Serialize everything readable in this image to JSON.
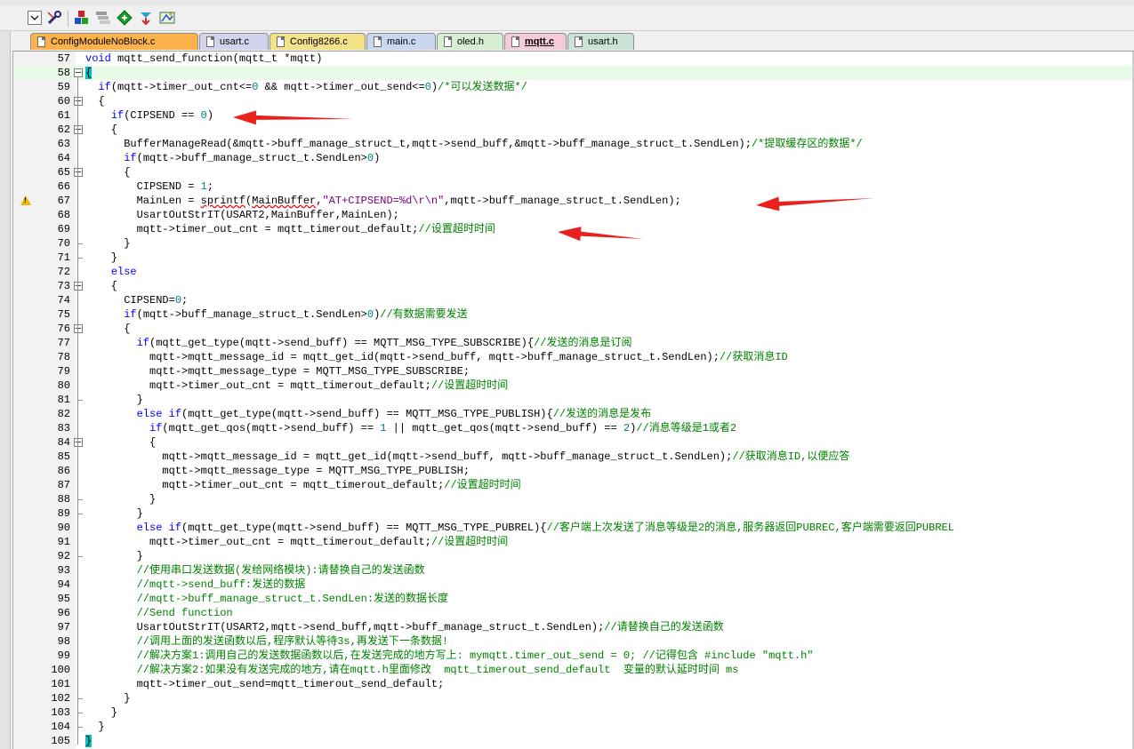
{
  "tabs": [
    {
      "label": "ConfigModuleNoBlock.c",
      "bg": "#fbb24a",
      "active": false
    },
    {
      "label": "usart.c",
      "bg": "#d3d3ee",
      "active": false
    },
    {
      "label": "Config8266.c",
      "bg": "#f4e28a",
      "active": false
    },
    {
      "label": "main.c",
      "bg": "#c9d8ee",
      "active": false
    },
    {
      "label": "oled.h",
      "bg": "#d7eed2",
      "active": false
    },
    {
      "label": "mqtt.c",
      "bg": "#f6cbd8",
      "active": true
    },
    {
      "label": "usart.h",
      "bg": "#c9e4d6",
      "active": false
    }
  ],
  "toolbar_icons": [
    "dropdown-icon",
    "wrench-icon",
    "build-target-icon",
    "batch-build-icon",
    "translate-icon",
    "download-icon",
    "options-icon"
  ],
  "editor": {
    "highlight_line": 58,
    "warning_line": 67,
    "lines": [
      {
        "n": "57",
        "text": "void mqtt_send_function(mqtt_t *mqtt)"
      },
      {
        "n": "58",
        "text": "{"
      },
      {
        "n": "59",
        "text": "  if(mqtt->timer_out_cnt<=0 && mqtt->timer_out_send<=0)/*可以发送数据*/"
      },
      {
        "n": "60",
        "text": "  {"
      },
      {
        "n": "61",
        "text": "    if(CIPSEND == 0)"
      },
      {
        "n": "62",
        "text": "    {"
      },
      {
        "n": "63",
        "text": "      BufferManageRead(&mqtt->buff_manage_struct_t,mqtt->send_buff,&mqtt->buff_manage_struct_t.SendLen);/*提取缓存区的数据*/"
      },
      {
        "n": "64",
        "text": "      if(mqtt->buff_manage_struct_t.SendLen>0)"
      },
      {
        "n": "65",
        "text": "      {"
      },
      {
        "n": "66",
        "text": "        CIPSEND = 1;"
      },
      {
        "n": "67",
        "text": "        MainLen = sprintf(MainBuffer,\"AT+CIPSEND=%d\\r\\n\",mqtt->buff_manage_struct_t.SendLen);"
      },
      {
        "n": "68",
        "text": "        UsartOutStrIT(USART2,MainBuffer,MainLen);"
      },
      {
        "n": "69",
        "text": "        mqtt->timer_out_cnt = mqtt_timerout_default;//设置超时时间"
      },
      {
        "n": "70",
        "text": "      }"
      },
      {
        "n": "71",
        "text": "    }"
      },
      {
        "n": "72",
        "text": "    else"
      },
      {
        "n": "73",
        "text": "    {"
      },
      {
        "n": "74",
        "text": "      CIPSEND=0;"
      },
      {
        "n": "75",
        "text": "      if(mqtt->buff_manage_struct_t.SendLen>0)//有数据需要发送"
      },
      {
        "n": "76",
        "text": "      {"
      },
      {
        "n": "77",
        "text": "        if(mqtt_get_type(mqtt->send_buff) == MQTT_MSG_TYPE_SUBSCRIBE){//发送的消息是订阅"
      },
      {
        "n": "78",
        "text": "          mqtt->mqtt_message_id = mqtt_get_id(mqtt->send_buff, mqtt->buff_manage_struct_t.SendLen);//获取消息ID"
      },
      {
        "n": "79",
        "text": "          mqtt->mqtt_message_type = MQTT_MSG_TYPE_SUBSCRIBE;"
      },
      {
        "n": "80",
        "text": "          mqtt->timer_out_cnt = mqtt_timerout_default;//设置超时时间"
      },
      {
        "n": "81",
        "text": "        }"
      },
      {
        "n": "82",
        "text": "        else if(mqtt_get_type(mqtt->send_buff) == MQTT_MSG_TYPE_PUBLISH){//发送的消息是发布"
      },
      {
        "n": "83",
        "text": "          if(mqtt_get_qos(mqtt->send_buff) == 1 || mqtt_get_qos(mqtt->send_buff) == 2)//消息等级是1或者2"
      },
      {
        "n": "84",
        "text": "          {"
      },
      {
        "n": "85",
        "text": "            mqtt->mqtt_message_id = mqtt_get_id(mqtt->send_buff, mqtt->buff_manage_struct_t.SendLen);//获取消息ID,以便应答"
      },
      {
        "n": "86",
        "text": "            mqtt->mqtt_message_type = MQTT_MSG_TYPE_PUBLISH;"
      },
      {
        "n": "87",
        "text": "            mqtt->timer_out_cnt = mqtt_timerout_default;//设置超时时间"
      },
      {
        "n": "88",
        "text": "          }"
      },
      {
        "n": "89",
        "text": "        }"
      },
      {
        "n": "90",
        "text": "        else if(mqtt_get_type(mqtt->send_buff) == MQTT_MSG_TYPE_PUBREL){//客户端上次发送了消息等级是2的消息,服务器返回PUBREC,客户端需要返回PUBREL"
      },
      {
        "n": "91",
        "text": "          mqtt->timer_out_cnt = mqtt_timerout_default;//设置超时时间"
      },
      {
        "n": "92",
        "text": "        }"
      },
      {
        "n": "93",
        "text": "        //使用串口发送数据(发给网络模块):请替换自己的发送函数"
      },
      {
        "n": "94",
        "text": "        //mqtt->send_buff:发送的数据"
      },
      {
        "n": "95",
        "text": "        //mqtt->buff_manage_struct_t.SendLen:发送的数据长度"
      },
      {
        "n": "96",
        "text": "        //Send function"
      },
      {
        "n": "97",
        "text": "        UsartOutStrIT(USART2,mqtt->send_buff,mqtt->buff_manage_struct_t.SendLen);//请替换自己的发送函数"
      },
      {
        "n": "98",
        "text": "        //调用上面的发送函数以后,程序默认等待3s,再发送下一条数据!"
      },
      {
        "n": "99",
        "text": "        //解决方案1:调用自己的发送数据函数以后,在发送完成的地方写上: mymqtt.timer_out_send = 0; //记得包含 #include \"mqtt.h\""
      },
      {
        "n": "100",
        "text": "        //解决方案2:如果没有发送完成的地方,请在mqtt.h里面修改  mqtt_timerout_send_default  变量的默认延时时间 ms"
      },
      {
        "n": "101",
        "text": "        mqtt->timer_out_send=mqtt_timerout_send_default;"
      },
      {
        "n": "102",
        "text": "      }"
      },
      {
        "n": "103",
        "text": "    }"
      },
      {
        "n": "104",
        "text": "  }"
      },
      {
        "n": "105",
        "text": "}"
      }
    ]
  },
  "annotation_color": "#e8201e"
}
